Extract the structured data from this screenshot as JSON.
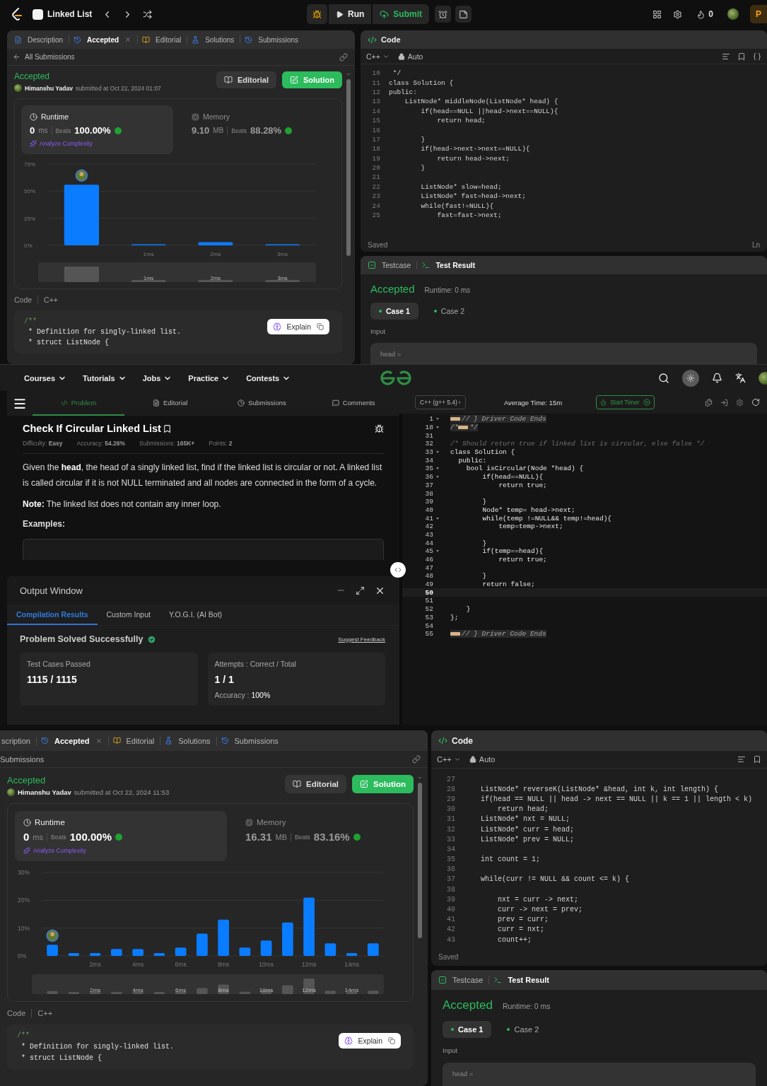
{
  "leetcode_top": {
    "navbar": {
      "title": "Linked List",
      "run": "Run",
      "submit": "Submit",
      "streak": "0",
      "premium": "P"
    },
    "left": {
      "tabs": [
        {
          "label": "Description",
          "selected": false,
          "closable": false
        },
        {
          "label": "Accepted",
          "selected": true,
          "closable": true
        },
        {
          "label": "Editorial",
          "selected": false,
          "closable": false
        },
        {
          "label": "Solutions",
          "selected": false,
          "closable": false
        },
        {
          "label": "Submissions",
          "selected": false,
          "closable": false
        }
      ],
      "back": {
        "label": "All Submissions",
        "arrow": true
      },
      "status": "Accepted",
      "author": "Himanshu Yadav",
      "submitted": "submitted at Oct 22, 2024 01:07",
      "editorial_button": "Editorial",
      "solution_button": "Solution",
      "runtime": {
        "label": "Runtime",
        "value": "0",
        "unit": "ms",
        "beats_label": "Beats",
        "beats": "100.00%",
        "analyze": "Analyze Complexity",
        "selected": true
      },
      "memory": {
        "label": "Memory",
        "value": "9.10",
        "unit": "MB",
        "beats_label": "Beats",
        "beats": "88.28%",
        "selected": false
      },
      "chart_data": {
        "type": "bar",
        "xlim": [
          -0.5,
          3.5
        ],
        "x": [
          0,
          1,
          2,
          3
        ],
        "values": [
          56,
          1,
          3,
          1
        ],
        "ylim": [
          0,
          75
        ],
        "yticks": [
          {
            "value": 0,
            "label": "0%"
          },
          {
            "value": 25,
            "label": "25%"
          },
          {
            "value": 50,
            "label": "50%"
          },
          {
            "value": 75,
            "label": "75%"
          }
        ],
        "xticks": [
          {
            "value": 1,
            "label": "1ms"
          },
          {
            "value": 2,
            "label": "2ms"
          },
          {
            "value": 3,
            "label": "3ms"
          }
        ]
      },
      "navigator_labels": [
        "1ms",
        "2ms",
        "3ms"
      ],
      "code_label": "Code",
      "code_language": "C++",
      "code_lines": [
        {
          "text": "/**",
          "kind": "doc"
        },
        {
          "text": " * Definition for singly-linked list.",
          "kind": "code"
        },
        {
          "text": " * struct ListNode {",
          "kind": "code"
        }
      ],
      "explain_button": "Explain"
    },
    "code_panel": {
      "title": "Code",
      "language": "C++",
      "mode": "Auto",
      "status": "Saved",
      "cursor": "Ln",
      "lines": [
        {
          "number": "10",
          "text": " */"
        },
        {
          "number": "11",
          "text": "class Solution {"
        },
        {
          "number": "12",
          "text": "public:"
        },
        {
          "number": "13",
          "text": "    ListNode* middleNode(ListNode* head) {"
        },
        {
          "number": "14",
          "text": "        if(head==NULL ||head->next==NULL){"
        },
        {
          "number": "15",
          "text": "            return head;"
        },
        {
          "number": "16"
        },
        {
          "number": "17",
          "text": "        }"
        },
        {
          "number": "18",
          "text": "        if(head->next->next==NULL){"
        },
        {
          "number": "19",
          "text": "            return head->next;"
        },
        {
          "number": "20",
          "text": "        }"
        },
        {
          "number": "21"
        },
        {
          "number": "22",
          "text": "        ListNode* slow=head;"
        },
        {
          "number": "23",
          "text": "        ListNode* fast=head->next;"
        },
        {
          "number": "24",
          "text": "        while(fast!=NULL){"
        },
        {
          "number": "25",
          "text": "            fast=fast->next;"
        }
      ]
    },
    "result_panel": {
      "tabs": [
        {
          "label": "Testcase",
          "selected": false
        },
        {
          "label": "Test Result",
          "selected": true
        }
      ],
      "verdict": "Accepted",
      "runtime": "Runtime: 0 ms",
      "cases": [
        {
          "label": "Case 1",
          "selected": true
        },
        {
          "label": "Case 2",
          "selected": false
        }
      ],
      "input_label": "Input",
      "input_value": "head ="
    }
  },
  "gfg": {
    "nav": [
      "Courses",
      "Tutorials",
      "Jobs",
      "Practice",
      "Contests"
    ],
    "tabs": [
      {
        "label": "Problem",
        "selected": true
      },
      {
        "label": "Editorial",
        "selected": false
      },
      {
        "label": "Submissions",
        "selected": false
      },
      {
        "label": "Comments",
        "selected": false
      }
    ],
    "title": "Check If Circular Linked List",
    "meta": [
      {
        "label": "Difficulty:",
        "value": "Easy"
      },
      {
        "label": "Accuracy:",
        "value": "54.26%"
      },
      {
        "label": "Submissions:",
        "value": "165K+"
      },
      {
        "label": "Points:",
        "value": "2"
      }
    ],
    "paragraphs": [
      "Given the **head**, the head of a singly linked list, find if the linked list is circular or not. A linked list is called circular if it is not NULL terminated and all nodes are connected in the form of a cycle.",
      "**Note:** The linked list does not contain any inner loop."
    ],
    "examples_heading": "Examples:",
    "output_window": {
      "title": "Output Window",
      "tabs": [
        {
          "label": "Compilation Results",
          "selected": true
        },
        {
          "label": "Custom Input",
          "selected": false
        },
        {
          "label": "Y.O.G.I. (AI Bot)",
          "selected": false
        }
      ],
      "result": "Problem Solved Successfully",
      "feedback": "Suggest Feedback",
      "stats": [
        {
          "label": "Test Cases Passed",
          "value": "1115 / 1115"
        },
        {
          "label": "Attempts : Correct / Total",
          "value": "1 / 1",
          "note_label": "Accuracy :",
          "note_value": "100%"
        }
      ]
    },
    "editor": {
      "language": "C++ (g++ 5.4)",
      "average_time": "Average Time: 15m",
      "timer": "Start Timer",
      "lines": [
        {
          "number": "1",
          "kind": "folded",
          "text": "// } Driver Code Ends",
          "fold": true,
          "active": false
        },
        {
          "number": "18",
          "kind": "folded",
          "before": "/*",
          "text": "*/",
          "fold": true,
          "active": false
        },
        {
          "number": "31",
          "kind": "code",
          "fold": false,
          "active": false
        },
        {
          "number": "32",
          "kind": "comment",
          "text": "/* Should return true if linked list is circular, else false */",
          "fold": false,
          "active": false
        },
        {
          "number": "33",
          "kind": "code",
          "text": "class Solution {",
          "fold": true,
          "active": false
        },
        {
          "number": "34",
          "kind": "code",
          "text": "  public:",
          "fold": false,
          "active": false
        },
        {
          "number": "35",
          "kind": "code",
          "text": "    bool isCircular(Node *head) {",
          "fold": true,
          "active": false
        },
        {
          "number": "36",
          "kind": "code",
          "text": "        if(head==NULL){",
          "fold": true,
          "active": false
        },
        {
          "number": "37",
          "kind": "code",
          "text": "            return true;",
          "fold": false,
          "active": false
        },
        {
          "number": "38",
          "kind": "code",
          "fold": false,
          "active": false
        },
        {
          "number": "39",
          "kind": "code",
          "text": "        }",
          "fold": false,
          "active": false
        },
        {
          "number": "40",
          "kind": "code",
          "text": "        Node* temp= head->next;",
          "fold": false,
          "active": false
        },
        {
          "number": "41",
          "kind": "code",
          "text": "        while(temp !=NULL&& temp!=head){",
          "fold": true,
          "active": false
        },
        {
          "number": "42",
          "kind": "code",
          "text": "            temp=temp->next;",
          "fold": false,
          "active": false
        },
        {
          "number": "43",
          "kind": "code",
          "fold": false,
          "active": false
        },
        {
          "number": "44",
          "kind": "code",
          "text": "        }",
          "fold": false,
          "active": false
        },
        {
          "number": "45",
          "kind": "code",
          "text": "        if(temp==head){",
          "fold": true,
          "active": false
        },
        {
          "number": "46",
          "kind": "code",
          "text": "            return true;",
          "fold": false,
          "active": false
        },
        {
          "number": "47",
          "kind": "code",
          "fold": false,
          "active": false
        },
        {
          "number": "48",
          "kind": "code",
          "text": "        }",
          "fold": false,
          "active": false
        },
        {
          "number": "49",
          "kind": "code",
          "text": "        return false;",
          "fold": false,
          "active": false
        },
        {
          "number": "50",
          "kind": "code",
          "fold": false,
          "active": true
        },
        {
          "number": "51",
          "kind": "code",
          "fold": false,
          "active": false
        },
        {
          "number": "52",
          "kind": "code",
          "text": "    }",
          "fold": false,
          "active": false
        },
        {
          "number": "53",
          "kind": "code",
          "text": "};",
          "fold": false,
          "active": false
        },
        {
          "number": "54",
          "kind": "code",
          "fold": false,
          "active": false
        },
        {
          "number": "55",
          "kind": "folded",
          "text": "// } Driver Code Ends",
          "fold": false,
          "active": false
        }
      ]
    }
  },
  "leetcode_bottom": {
    "left": {
      "tabs": [
        {
          "label": "scription",
          "selected": false,
          "closable": false
        },
        {
          "label": "Accepted",
          "selected": true,
          "closable": true
        },
        {
          "label": "Editorial",
          "selected": false,
          "closable": false
        },
        {
          "label": "Solutions",
          "selected": false,
          "closable": false
        },
        {
          "label": "Submissions",
          "selected": false,
          "closable": false
        }
      ],
      "back": {
        "label": "Submissions",
        "arrow": false
      },
      "status": "Accepted",
      "author": "Himanshu Yadav",
      "submitted": "submitted at Oct 22, 2024 11:53",
      "editorial_button": "Editorial",
      "solution_button": "Solution",
      "runtime": {
        "label": "Runtime",
        "value": "0",
        "unit": "ms",
        "beats_label": "Beats",
        "beats": "100.00%",
        "analyze": "Analyze Complexity",
        "selected": true
      },
      "memory": {
        "label": "Memory",
        "value": "16.31",
        "unit": "MB",
        "beats_label": "Beats",
        "beats": "83.16%",
        "selected": false
      },
      "chart_data": {
        "type": "bar",
        "xlim": [
          -0.5,
          15.5
        ],
        "x": [
          0,
          1,
          2,
          3,
          4,
          5,
          6,
          7,
          8,
          9,
          10,
          11,
          12,
          13,
          14,
          15
        ],
        "values": [
          4,
          1,
          1,
          2.5,
          2.5,
          1,
          3,
          8,
          13,
          3,
          5.5,
          12,
          21,
          4.5,
          1,
          4.5
        ],
        "ylim": [
          0,
          30
        ],
        "yticks": [
          {
            "value": 0,
            "label": "0%"
          },
          {
            "value": 10,
            "label": "10%"
          },
          {
            "value": 20,
            "label": "20%"
          },
          {
            "value": 30,
            "label": "30%"
          }
        ],
        "xticks": [
          {
            "value": 2,
            "label": "2ms"
          },
          {
            "value": 4,
            "label": "4ms"
          },
          {
            "value": 6,
            "label": "6ms"
          },
          {
            "value": 8,
            "label": "8ms"
          },
          {
            "value": 10,
            "label": "10ms"
          },
          {
            "value": 12,
            "label": "12ms"
          },
          {
            "value": 14,
            "label": "14ms"
          }
        ]
      },
      "navigator_labels": [
        "2ms",
        "4ms",
        "6ms",
        "8ms",
        "10ms",
        "12ms",
        "14ms"
      ],
      "code_label": "Code",
      "code_language": "C++",
      "code_lines": [
        {
          "text": "/**",
          "kind": "doc"
        },
        {
          "text": " * Definition for singly-linked list.",
          "kind": "code"
        },
        {
          "text": " * struct ListNode {",
          "kind": "code"
        }
      ],
      "explain_button": "Explain"
    },
    "code_panel": {
      "title": "Code",
      "language": "C++",
      "mode": "Auto",
      "status": "Saved",
      "lines": [
        {
          "number": "27"
        },
        {
          "number": "28",
          "text": "    ListNode* reverseK(ListNode* &head, int k, int length) {"
        },
        {
          "number": "29",
          "text": "    if(head == NULL || head -> next == NULL || k == 1 || length < k)"
        },
        {
          "number": "30",
          "text": "        return head;"
        },
        {
          "number": "31",
          "text": "    ListNode* nxt = NULL;"
        },
        {
          "number": "32",
          "text": "    ListNode* curr = head;"
        },
        {
          "number": "33",
          "text": "    ListNode* prev = NULL;"
        },
        {
          "number": "34"
        },
        {
          "number": "35",
          "text": "    int count = 1;"
        },
        {
          "number": "36"
        },
        {
          "number": "37",
          "text": "    while(curr != NULL && count <= k) {"
        },
        {
          "number": "38"
        },
        {
          "number": "39",
          "text": "        nxt = curr -> next;"
        },
        {
          "number": "40",
          "text": "        curr -> next = prev;"
        },
        {
          "number": "41",
          "text": "        prev = curr;"
        },
        {
          "number": "42",
          "text": "        curr = nxt;"
        },
        {
          "number": "43",
          "text": "        count++;"
        }
      ]
    },
    "result_panel": {
      "tabs": [
        {
          "label": "Testcase",
          "selected": false
        },
        {
          "label": "Test Result",
          "selected": true
        }
      ],
      "verdict": "Accepted",
      "runtime": "Runtime: 0 ms",
      "cases": [
        {
          "label": "Case 1",
          "selected": true
        },
        {
          "label": "Case 2",
          "selected": false
        }
      ],
      "input_label": "Input",
      "input_value": "head ="
    }
  }
}
